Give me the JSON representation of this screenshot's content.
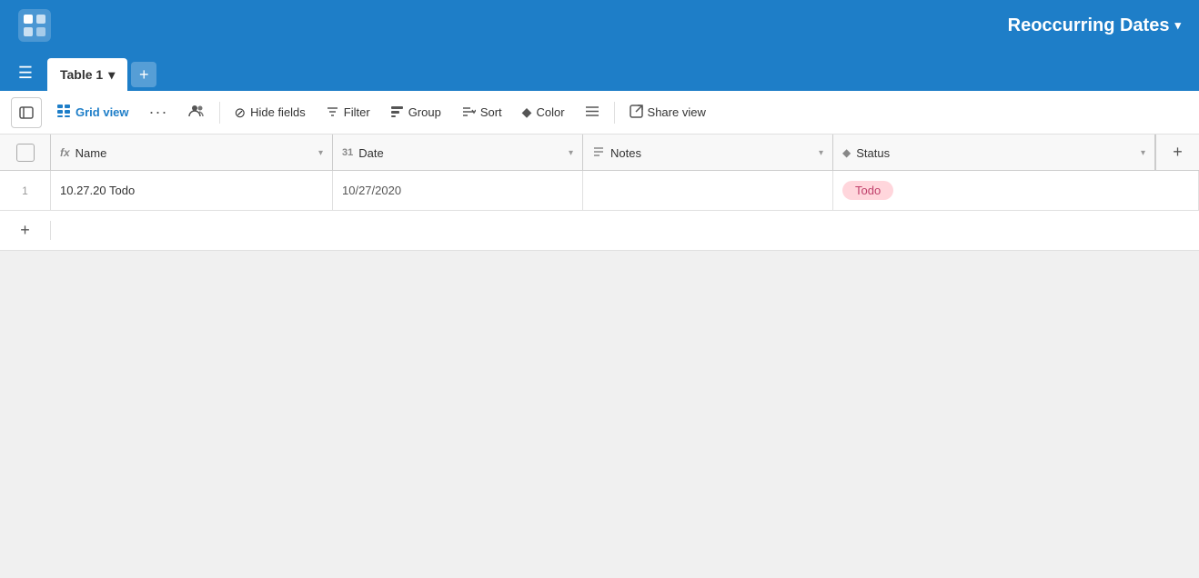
{
  "app": {
    "logo_alt": "Airtable logo",
    "title": "Reoccurring Dates",
    "title_arrow": "▾"
  },
  "tabs": {
    "hamburger_icon": "☰",
    "active_tab": "Table 1",
    "tab_arrow": "▾",
    "add_tab_icon": "+"
  },
  "toolbar": {
    "toggle_icon": "☰",
    "grid_icon": "⊞",
    "grid_label": "Grid view",
    "more_icon": "···",
    "collab_icon": "👥",
    "hide_icon": "⊘",
    "hide_label": "Hide fields",
    "filter_icon": "≡",
    "filter_label": "Filter",
    "group_icon": "▤",
    "group_label": "Group",
    "sort_icon": "↕",
    "sort_label": "Sort",
    "color_icon": "◆",
    "color_label": "Color",
    "row_height_icon": "≡",
    "share_icon": "↗",
    "share_label": "Share view"
  },
  "columns": [
    {
      "id": "name",
      "icon": "fx",
      "label": "Name"
    },
    {
      "id": "date",
      "icon": "31",
      "label": "Date"
    },
    {
      "id": "notes",
      "icon": "≡",
      "label": "Notes"
    },
    {
      "id": "status",
      "icon": "◆",
      "label": "Status"
    }
  ],
  "rows": [
    {
      "num": "1",
      "name": "10.27.20 Todo",
      "date": "10/27/2020",
      "notes": "",
      "status": "Todo",
      "status_color": "#ffd6dc"
    }
  ],
  "add_row_icon": "+",
  "add_col_icon": "+"
}
